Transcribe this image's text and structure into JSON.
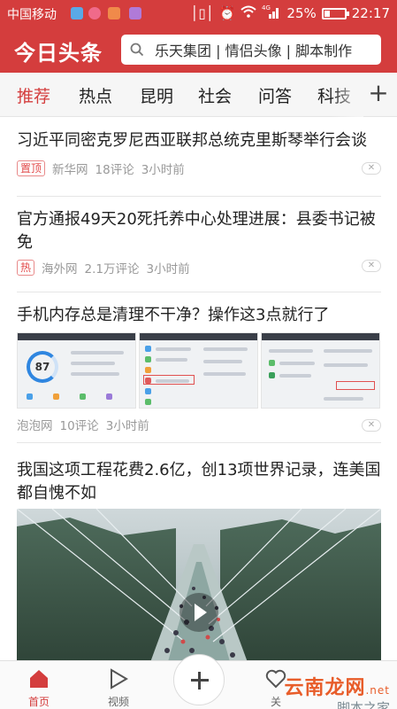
{
  "status_bar": {
    "carrier": "中国移动",
    "network": "4G",
    "battery_percent": "25%",
    "time": "22:17",
    "battery_level": 0.25
  },
  "header": {
    "logo": "今日头条",
    "search_placeholder": "乐天集团 | 情侣头像 | 脚本制作"
  },
  "tabs": [
    {
      "label": "推荐",
      "active": true
    },
    {
      "label": "热点",
      "active": false
    },
    {
      "label": "昆明",
      "active": false
    },
    {
      "label": "社会",
      "active": false
    },
    {
      "label": "问答",
      "active": false
    },
    {
      "label": "科技",
      "active": false
    }
  ],
  "articles": [
    {
      "title": "习近平同密克罗尼西亚联邦总统克里斯琴举行会谈",
      "badge": "置顶",
      "source": "新华网",
      "comments": "18评论",
      "time": "3小时前"
    },
    {
      "title": "官方通报49天20死托养中心处理进展：县委书记被免",
      "badge": "热",
      "source": "海外网",
      "comments": "2.1万评论",
      "time": "3小时前"
    },
    {
      "title": "手机内存总是清理不干净？操作这3点就行了",
      "source": "泡泡网",
      "comments": "10评论",
      "time": "3小时前",
      "gauge_value": "87"
    },
    {
      "title": "我国这项工程花费2.6亿，创13项世界记录，连美国都自愧不如"
    }
  ],
  "bottom_nav": [
    {
      "label": "首页",
      "icon": "home-icon",
      "active": true
    },
    {
      "label": "视频",
      "icon": "video-play-icon",
      "active": false
    },
    {
      "label": "关",
      "icon": "heart-icon",
      "active": false
    }
  ],
  "watermark": {
    "main": "云南龙网",
    "suffix": ".net",
    "sub": "脚本之家"
  },
  "colors": {
    "brand_red": "#d43d3d",
    "text": "#222222",
    "meta": "#999999"
  }
}
